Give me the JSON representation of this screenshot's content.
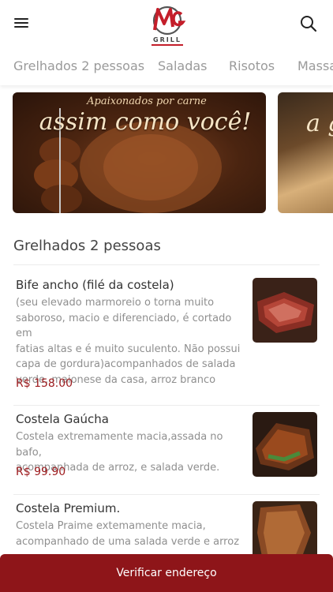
{
  "header": {
    "logo_wordmark": "GRILL",
    "menu_icon": "hamburger-menu-icon",
    "search_icon": "search-icon",
    "brand_color": "#c41e2a"
  },
  "tabs": [
    {
      "label": "Grelhados 2 pessoas"
    },
    {
      "label": "Saladas"
    },
    {
      "label": "Risotos"
    },
    {
      "label": "Massas"
    }
  ],
  "banners": [
    {
      "kicker": "Apaixonados por carne",
      "headline": "assim como você!"
    },
    {
      "headline": "a g"
    }
  ],
  "section": {
    "title": "Grelhados 2 pessoas"
  },
  "items": [
    {
      "name": "Bife ancho (filé da costela)",
      "desc_lines": [
        "(seu elevado marmoreio o torna muito",
        "saboroso, macio e diferenciado, é cortado em",
        "fatias altas e é muito suculento. Não possui",
        "capa de gordura)acompanhados de salada",
        "verde, maionese da casa, arroz branco"
      ],
      "price": "R$ 158.00"
    },
    {
      "name": "Costela Gaúcha",
      "desc_lines": [
        "Costela extremamente macia,assada no bafo,",
        "acompanhada de arroz, e salada verde."
      ],
      "price": "R$ 99.90"
    },
    {
      "name": "Costela Premium.",
      "desc_lines": [
        "Costela Praime extemamente macia,",
        "acompanhado de uma salada verde e arroz"
      ],
      "price": ""
    }
  ],
  "footer": {
    "button_label": "Verificar endereço",
    "button_color": "#8e1519"
  }
}
